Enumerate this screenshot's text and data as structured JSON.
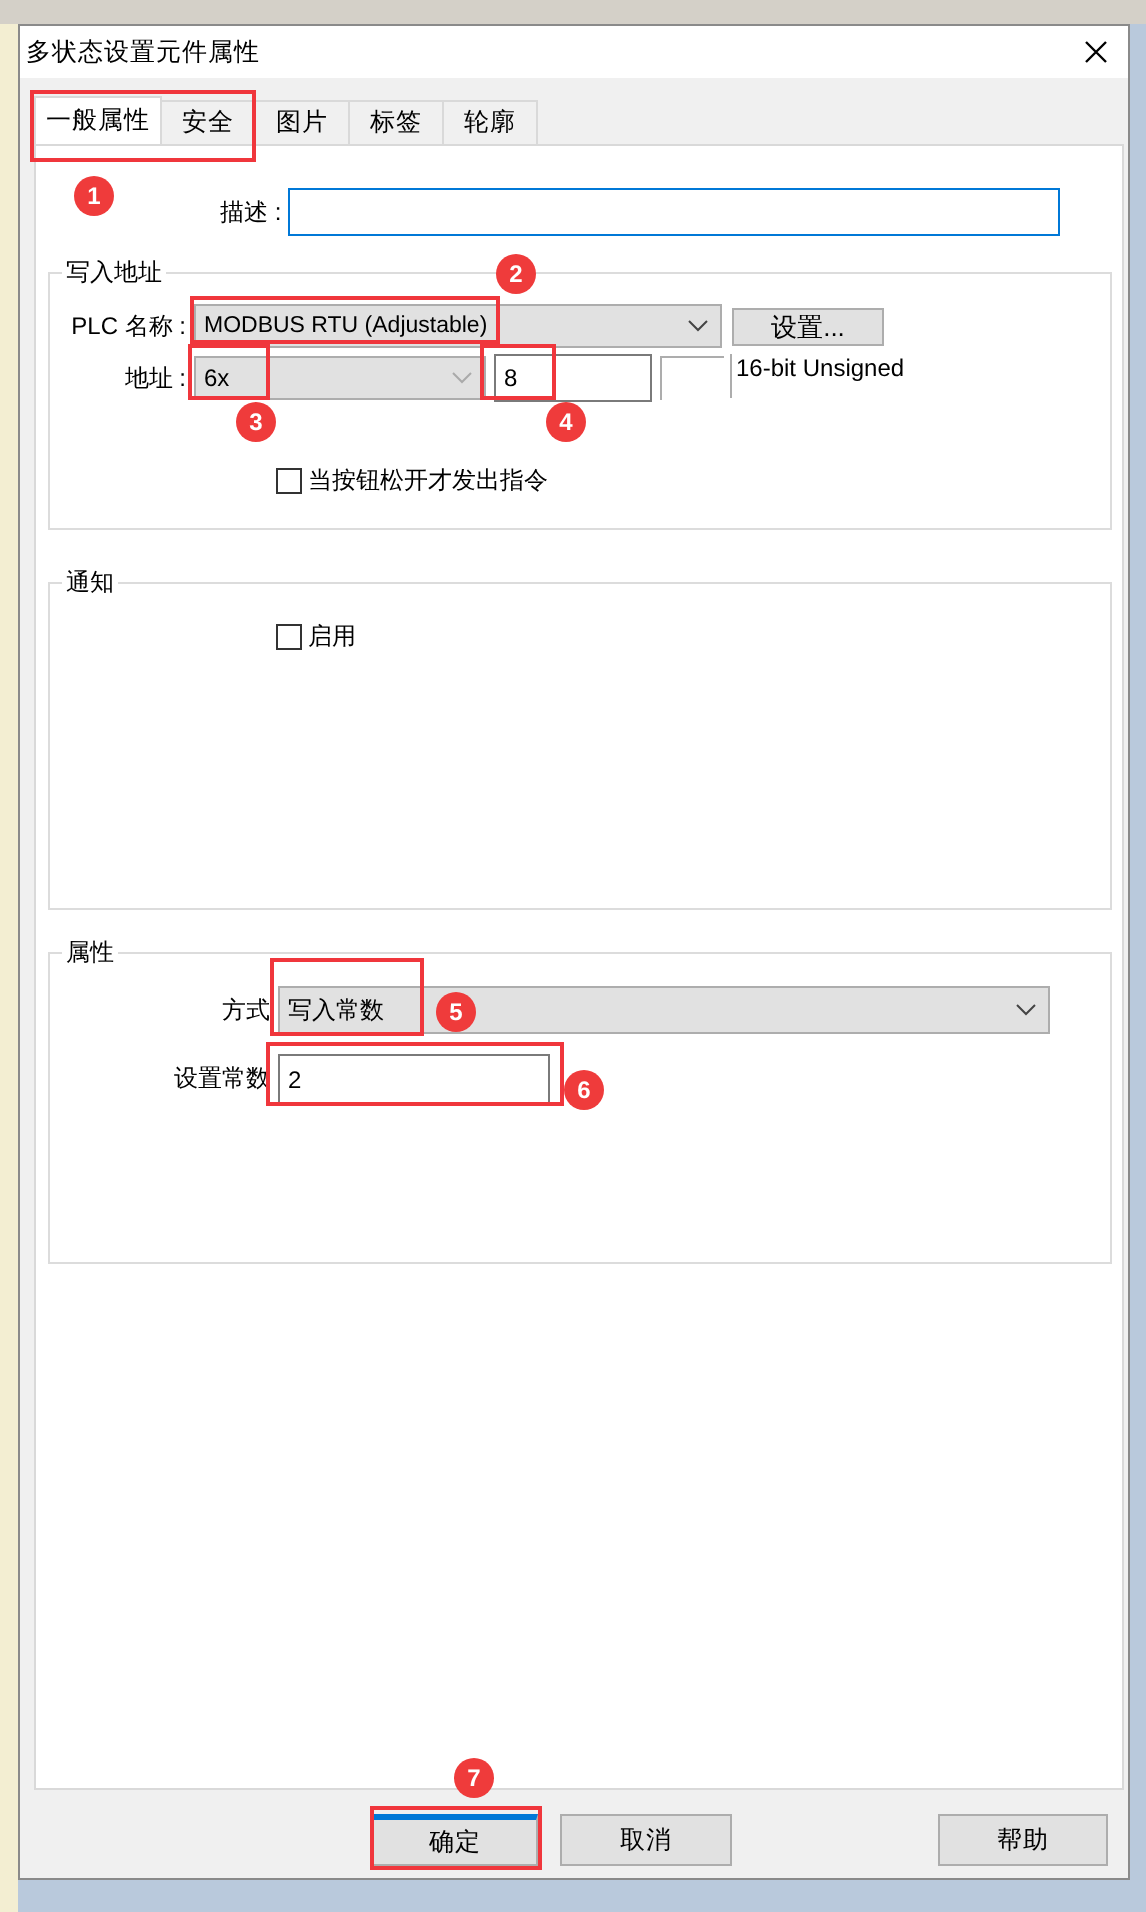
{
  "window": {
    "title": "多状态设置元件属性"
  },
  "tabs": [
    {
      "label": "一般属性",
      "selected": true
    },
    {
      "label": "安全",
      "selected": false
    },
    {
      "label": "图片",
      "selected": false
    },
    {
      "label": "标签",
      "selected": false
    },
    {
      "label": "轮廓",
      "selected": false
    }
  ],
  "description": {
    "label": "描述 :"
  },
  "write_address": {
    "title": "写入地址",
    "plc_name_label": "PLC 名称 :",
    "plc_name": "MODBUS RTU (Adjustable)",
    "settings_button": "设置...",
    "address_label": "地址 :",
    "address_type": "6x",
    "address_value": "8",
    "data_type": "16-bit Unsigned",
    "release_option": {
      "label": "当按钮松开才发出指令",
      "checked": false
    }
  },
  "notification": {
    "title": "通知",
    "enable": {
      "label": "启用",
      "checked": false
    }
  },
  "attributes": {
    "title": "属性",
    "mode_label": "方式",
    "mode": "写入常数",
    "constant_label": "设置常数",
    "constant": "2"
  },
  "buttons": [
    {
      "label": "确定",
      "focused": true
    },
    {
      "label": "取消",
      "focused": false
    },
    {
      "label": "帮助",
      "focused": false
    }
  ],
  "annotations": [
    {
      "number": "1"
    },
    {
      "number": "2"
    },
    {
      "number": "3"
    },
    {
      "number": "4"
    },
    {
      "number": "5"
    },
    {
      "number": "6"
    },
    {
      "number": "7"
    }
  ]
}
